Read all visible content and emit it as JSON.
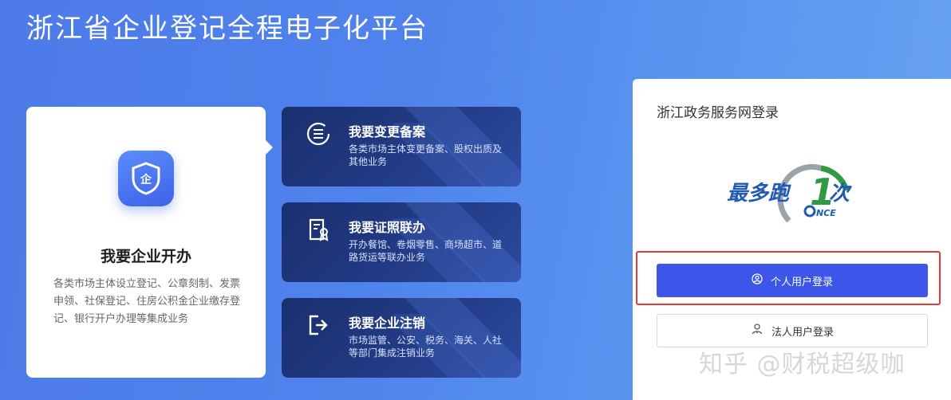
{
  "page": {
    "title": "浙江省企业登记全程电子化平台"
  },
  "main_card": {
    "title": "我要企业开办",
    "description": "各类市场主体设立登记、公章刻制、发票申领、社保登记、住房公积金企业缴存登记、银行开户办理等集成业务",
    "icon": "shield-enterprise-icon"
  },
  "services": [
    {
      "title": "我要变更备案",
      "description": "各类市场主体变更备案、股权出质及其他业务",
      "icon": "list-circle-icon"
    },
    {
      "title": "我要证照联办",
      "description": "开办餐馆、卷烟零售、商场超市、道路货运等联办业务",
      "icon": "license-icon"
    },
    {
      "title": "我要企业注销",
      "description": "市场监管、公安、税务、海关、人社等部门集成注销业务",
      "icon": "exit-icon"
    }
  ],
  "login": {
    "title": "浙江政务服务网登录",
    "logo": {
      "text": "最多跑",
      "num": "1",
      "text2": "次",
      "sub": "NCE"
    },
    "personal_label": "个人用户登录",
    "corporate_label": "法人用户登录"
  },
  "watermark": "知乎 @财税超级咖",
  "colors": {
    "primary": "#3d55e8",
    "highlight": "#e23b2f",
    "card_dark": "#223b86"
  }
}
